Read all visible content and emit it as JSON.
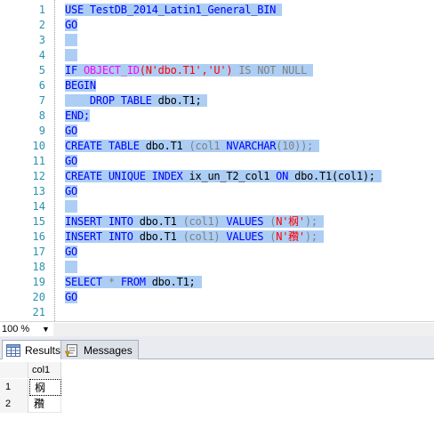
{
  "editor": {
    "line_numbers": [
      "1",
      "2",
      "3",
      "4",
      "5",
      "6",
      "7",
      "8",
      "9",
      "10",
      "11",
      "12",
      "13",
      "14",
      "15",
      "16",
      "17",
      "18",
      "19",
      "20",
      "21"
    ],
    "lines": {
      "l1": [
        "USE TestDB_2014_Latin1_General_BIN"
      ],
      "l2": [
        "GO"
      ],
      "l5": [
        "IF",
        "OBJECT_ID",
        "(N'dbo.T1','U')",
        "IS NOT NULL"
      ],
      "l6": [
        "BEGIN"
      ],
      "l7": [
        "DROP TABLE",
        "dbo.T1;"
      ],
      "l8": [
        "END;"
      ],
      "l9": [
        "GO"
      ],
      "l10": [
        "CREATE TABLE",
        "dbo.T1",
        "(col1",
        "NVARCHAR",
        "(10));"
      ],
      "l11": [
        "GO"
      ],
      "l12": [
        "CREATE UNIQUE INDEX",
        "ix_un_T2_col1",
        "ON",
        "dbo.T1(col1);"
      ],
      "l13": [
        "GO"
      ],
      "l15": [
        "INSERT INTO",
        "dbo.T1",
        "(col1)",
        "VALUES",
        "(",
        "N'㭎'",
        ");"
      ],
      "l16": [
        "INSERT INTO",
        "dbo.T1",
        "(col1)",
        "VALUES",
        "(",
        "N'䂎'",
        ");"
      ],
      "l17": [
        "GO"
      ],
      "l19": [
        "SELECT",
        "*",
        "FROM",
        "dbo.T1;"
      ],
      "l20": [
        "GO"
      ]
    }
  },
  "zoom": {
    "value": "100 %",
    "caret": "▼"
  },
  "tabs": {
    "results_label": "Results",
    "messages_label": "Messages"
  },
  "results": {
    "columns": [
      "col1"
    ],
    "rows": [
      {
        "num": "1",
        "col1": "㭎"
      },
      {
        "num": "2",
        "col1": "䂎"
      }
    ]
  },
  "colors": {
    "keyword": "#0000ff",
    "function": "#ff00ff",
    "string": "#ff0000",
    "operator": "#808080",
    "selection": "#adcef4",
    "line_number": "#2b91af"
  },
  "icons": [
    "results-grid-icon",
    "messages-icon",
    "dropdown-caret-icon"
  ]
}
